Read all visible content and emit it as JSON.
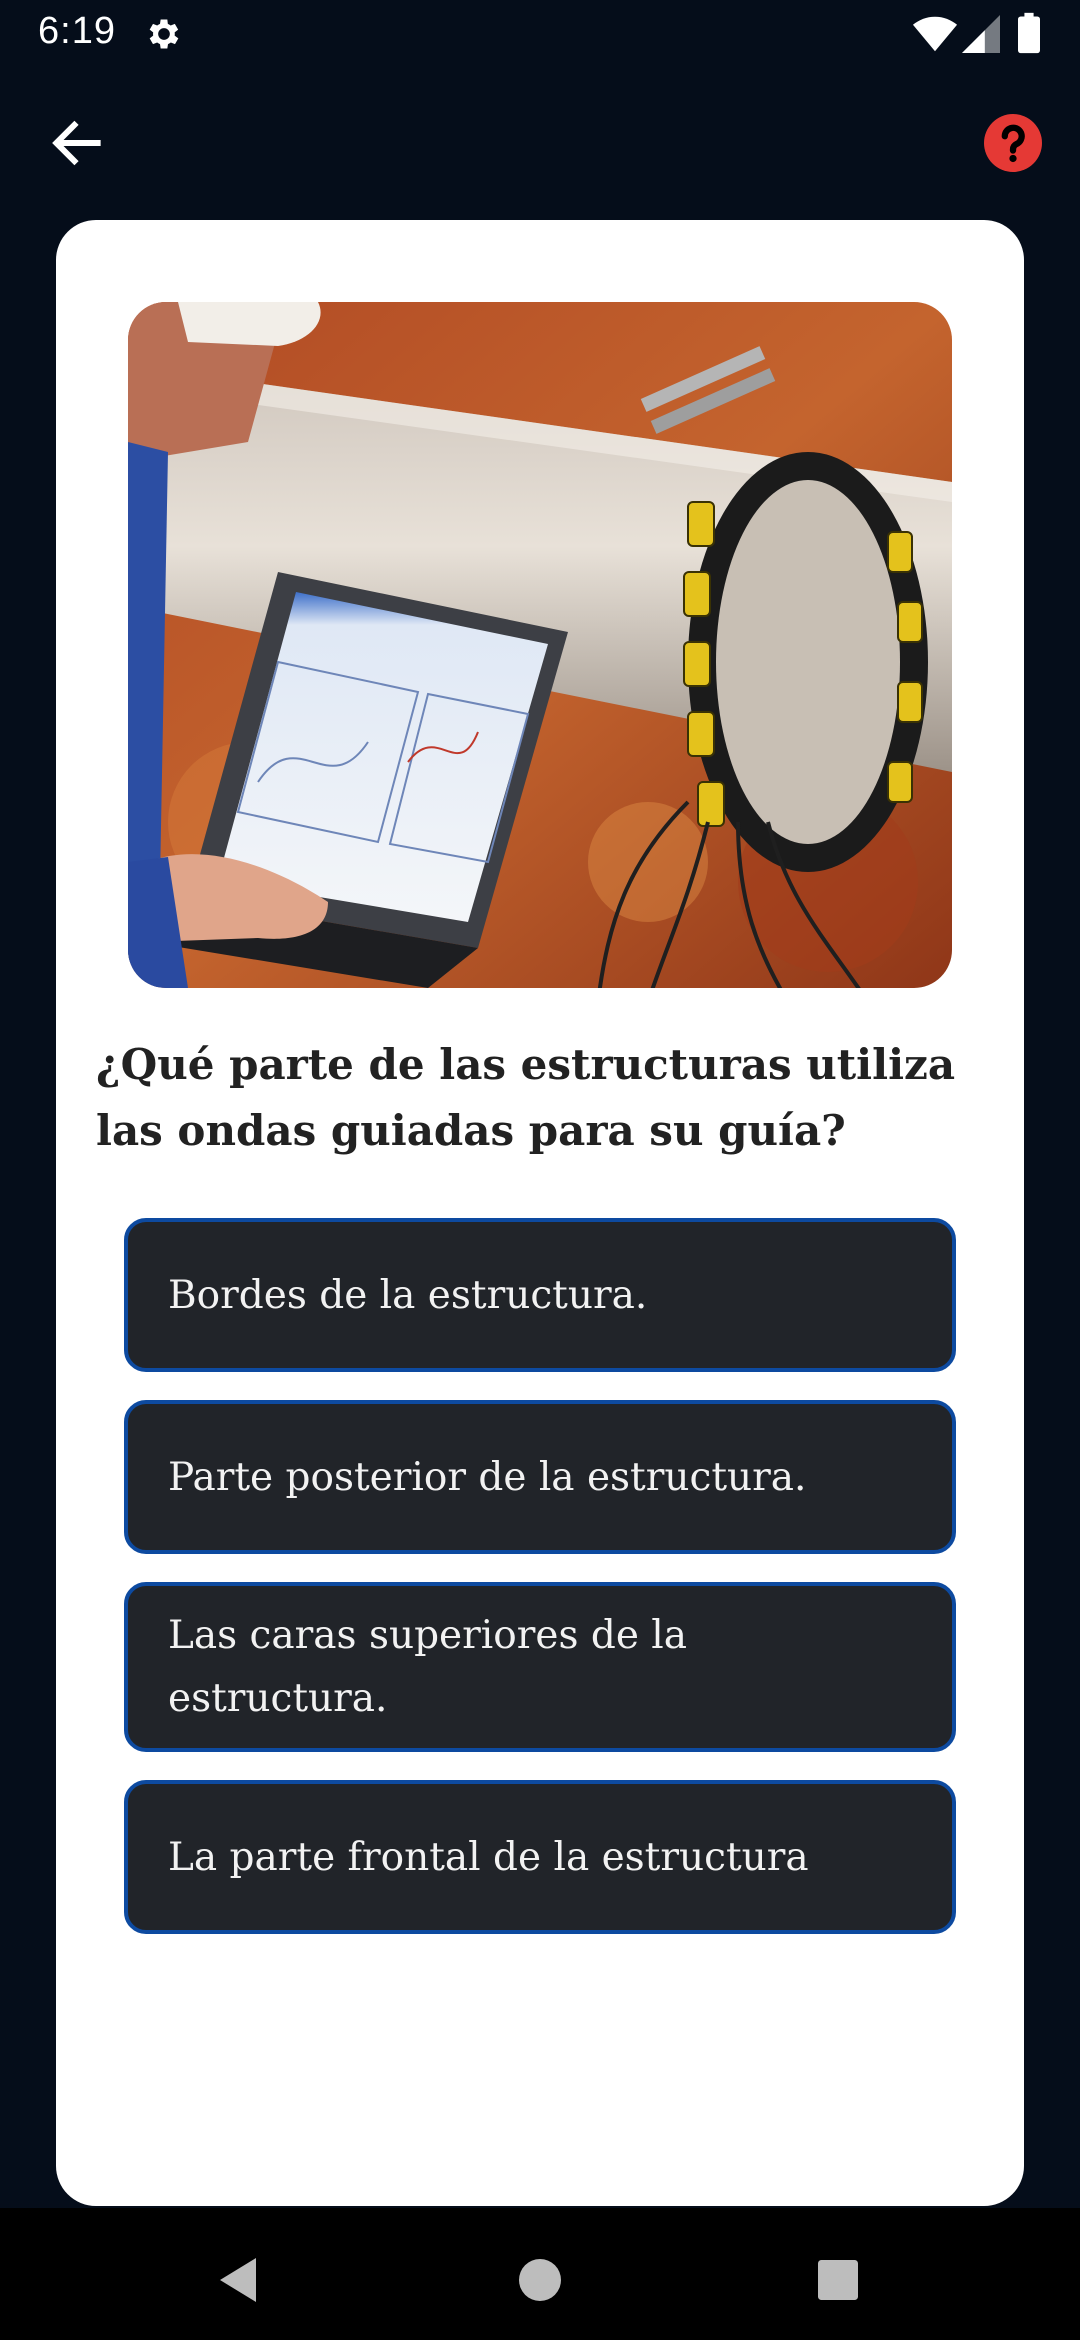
{
  "status_bar": {
    "time": "6:19",
    "icons": [
      "gear-icon",
      "wifi-icon",
      "signal-icon",
      "battery-icon"
    ]
  },
  "toolbar": {
    "back_icon": "arrow-left-icon",
    "help_icon": "question-mark-icon",
    "help_color": "#e53935"
  },
  "question": {
    "image_icon": "photo",
    "text": "¿Qué parte de las estructuras utiliza las ondas guiadas para su guía?"
  },
  "answers": [
    {
      "label": "Bordes de la estructura."
    },
    {
      "label": "Parte posterior de la estructura."
    },
    {
      "label": "Las caras superiores de la estructura."
    },
    {
      "label": "La parte frontal de la estructura"
    }
  ],
  "colors": {
    "background": "#050d1a",
    "card": "#ffffff",
    "answer_bg": "#212429",
    "answer_border": "#0d4aa0"
  },
  "nav_bar": {
    "icons": [
      "back-triangle-icon",
      "home-circle-icon",
      "recents-square-icon"
    ]
  }
}
